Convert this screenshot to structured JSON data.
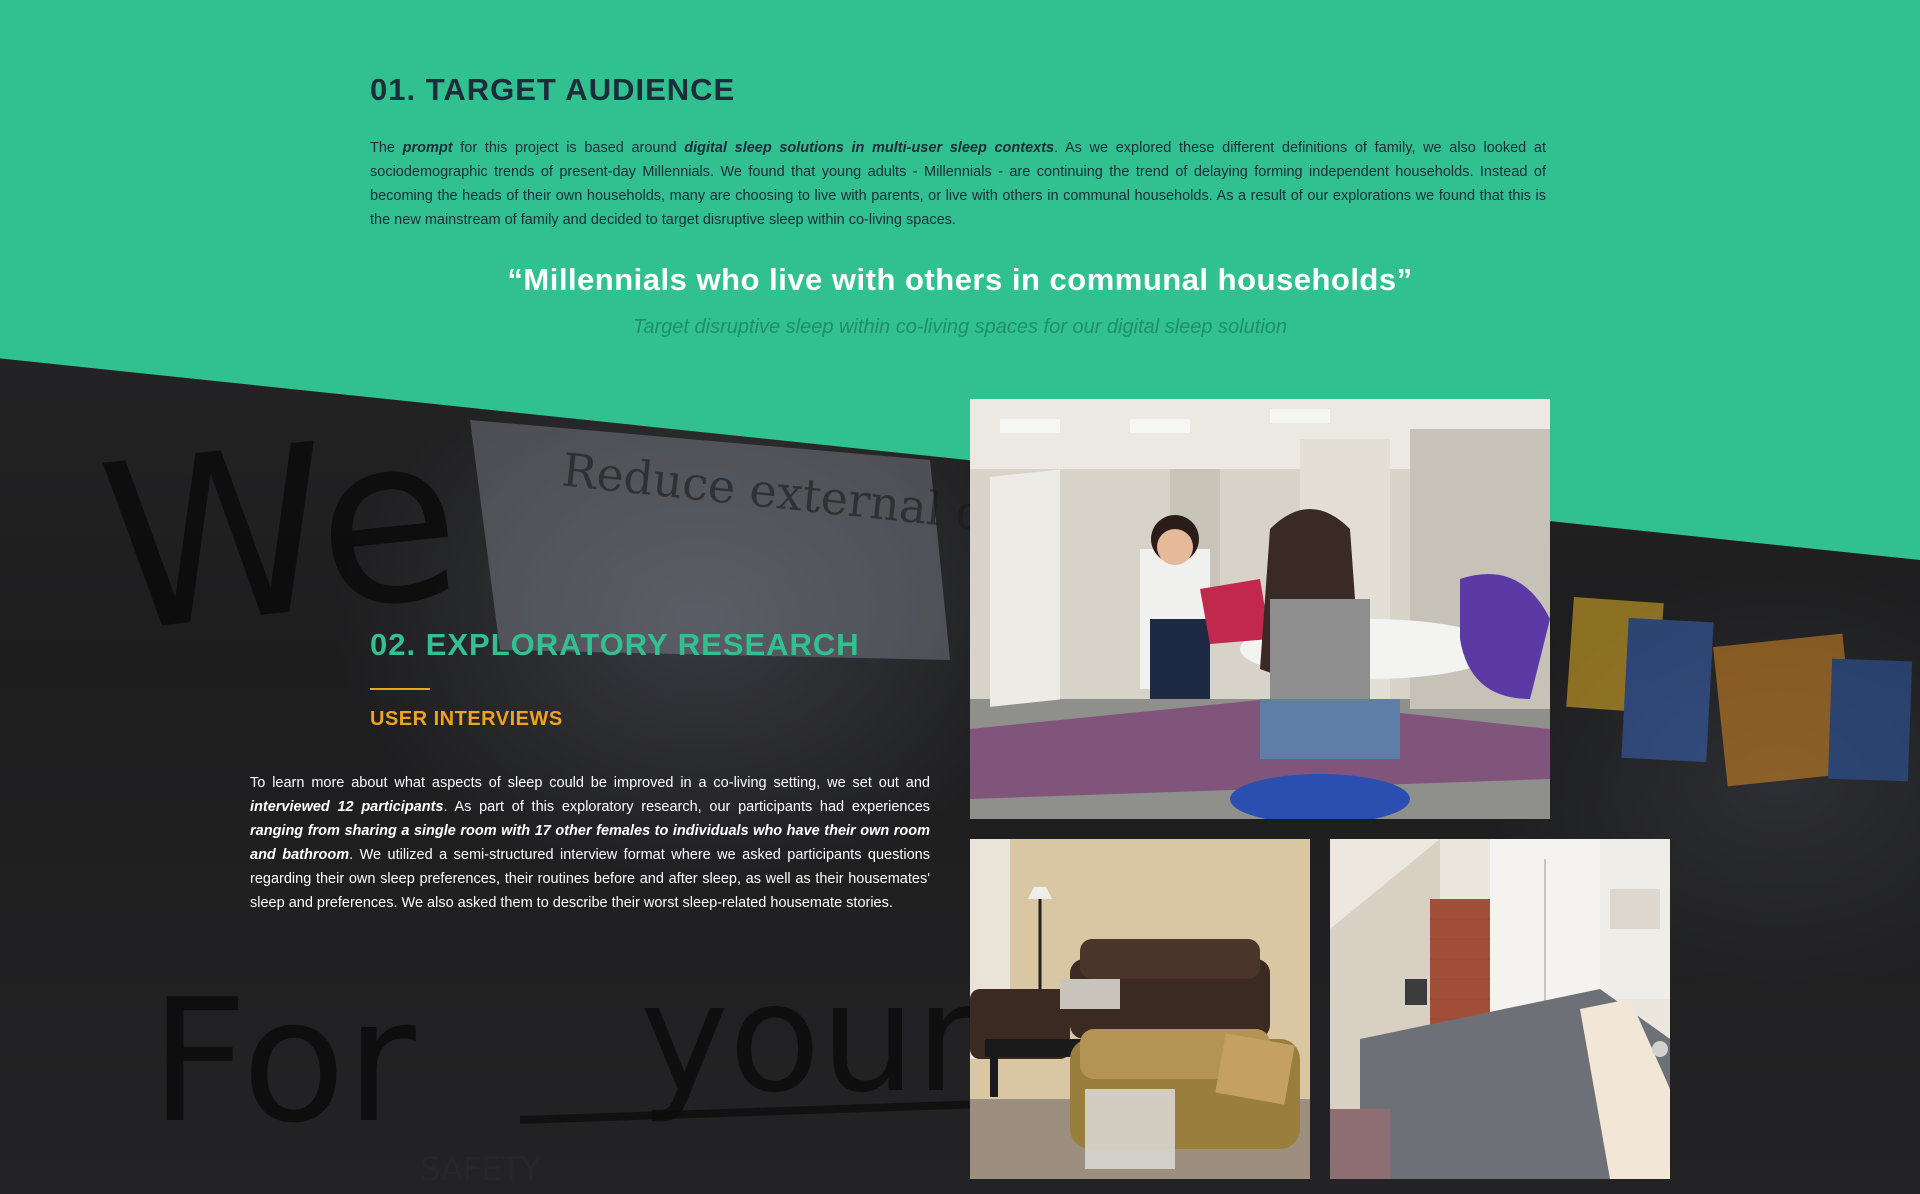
{
  "colors": {
    "accent_green": "#31c190",
    "heading_dark": "#1d2b3a",
    "accent_orange": "#f0a223",
    "background_dark": "#1f1f1f"
  },
  "target_audience": {
    "title": "01. TARGET AUDIENCE",
    "body_intro": "The ",
    "body_emph_1": "prompt",
    "body_mid_1": " for this project is based around ",
    "body_emph_2": "digital sleep solutions in multi-user sleep contexts",
    "body_rest": ". As we explored these different definitions of family, we also looked at sociodemographic trends of present-day Millennials. We found that young adults - Millennials - are continuing the trend of delaying forming independent households. Instead of becoming the heads of their own households, many are choosing to live with parents, or live with others in communal households. As a result of our explorations we found that this is the new mainstream of family and decided to target disruptive sleep within co-living spaces.",
    "quote": "“Millennials who live with others in communal households”",
    "quote_sub": "Target disruptive sleep within co-living spaces for our digital sleep solution"
  },
  "exploratory_research": {
    "title": "02. EXPLORATORY RESEARCH",
    "subtitle": "USER INTERVIEWS",
    "body_intro": "To learn more about what aspects of sleep could be improved in a co-living setting, we set out and ",
    "body_emph_1": "interviewed 12 participants",
    "body_mid_1": ". As part of this exploratory research, our participants had experiences ",
    "body_emph_2": "ranging from sharing a single room with 17 other females to individuals who have their own room and bathroom",
    "body_rest": ". We utilized a semi-structured interview format where we asked participants questions regarding their own sleep preferences, their routines before and after sleep, as well as their housemates' sleep and preferences. We also asked them to describe their worst sleep-related housemate stories."
  },
  "background_handwriting": {
    "word_1": "We",
    "note_1": "Reduce external disturbances",
    "word_2": "For",
    "word_3": "young",
    "note_2": "SAFETY"
  }
}
